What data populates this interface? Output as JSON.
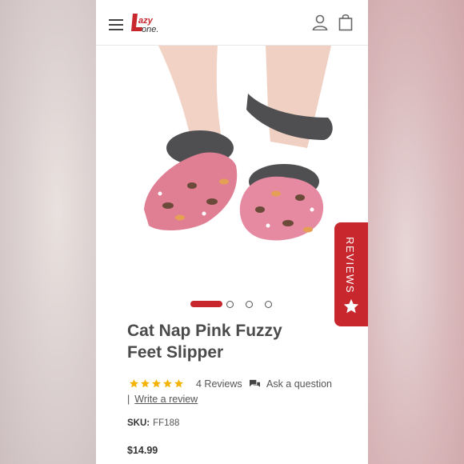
{
  "header": {
    "logo_text": "Lazy One",
    "icons": [
      "menu-icon",
      "account-icon",
      "shopping-bag-icon"
    ]
  },
  "product": {
    "image": "pink fuzzy slippers with cat print worn on feet",
    "title_line1": "Cat Nap Pink Fuzzy",
    "title_line2": "Feet Slipper",
    "rating": 5,
    "reviews_count": "4 Reviews",
    "ask_question": "Ask a question",
    "write_review": "Write a review",
    "sku_label": "SKU:",
    "sku_value": "FF188",
    "price": "$14.99"
  },
  "carousel": {
    "total": 4,
    "active": 1
  },
  "reviews_tab": {
    "label": "REVIEWS"
  },
  "colors": {
    "accent": "#c8272e",
    "star": "#f5b301",
    "text": "#4a4a4a",
    "slipper_pink": "#e07f93",
    "fur": "#4f4f52"
  }
}
